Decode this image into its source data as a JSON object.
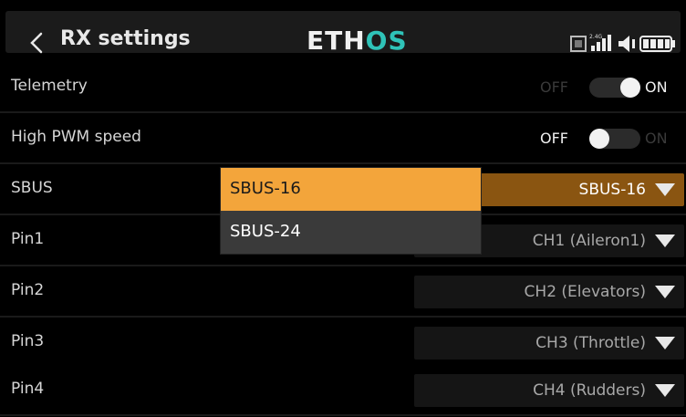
{
  "header": {
    "title": "RX settings",
    "brand_left": "ETH",
    "brand_right": "OS"
  },
  "rows": [
    {
      "label": "Telemetry",
      "type": "toggle",
      "off": "OFF",
      "on": "ON",
      "state": "on"
    },
    {
      "label": "High PWM speed",
      "type": "toggle",
      "off": "OFF",
      "on": "ON",
      "state": "off"
    },
    {
      "label": "SBUS",
      "type": "select",
      "value": "SBUS-16",
      "active": true
    },
    {
      "label": "Pin1",
      "type": "select",
      "value": "CH1 (Aileron1)"
    },
    {
      "label": "Pin2",
      "type": "select",
      "value": "CH2 (Elevators)"
    },
    {
      "label": "Pin3",
      "type": "select",
      "value": "CH3 (Throttle)"
    },
    {
      "label": "Pin4",
      "type": "select",
      "value": "CH4 (Rudders)"
    }
  ],
  "dropdown": {
    "options": [
      "SBUS-16",
      "SBUS-24"
    ],
    "selected_index": 0
  },
  "colors": {
    "accent": "#f3a53b",
    "active_select": "#8a5511",
    "brand_teal": "#2fc3b8",
    "toggle_on_track": "#2b2b2b"
  },
  "status_icons": [
    "storage-icon",
    "signal-2.4-icon",
    "volume-icon",
    "battery-icon"
  ]
}
